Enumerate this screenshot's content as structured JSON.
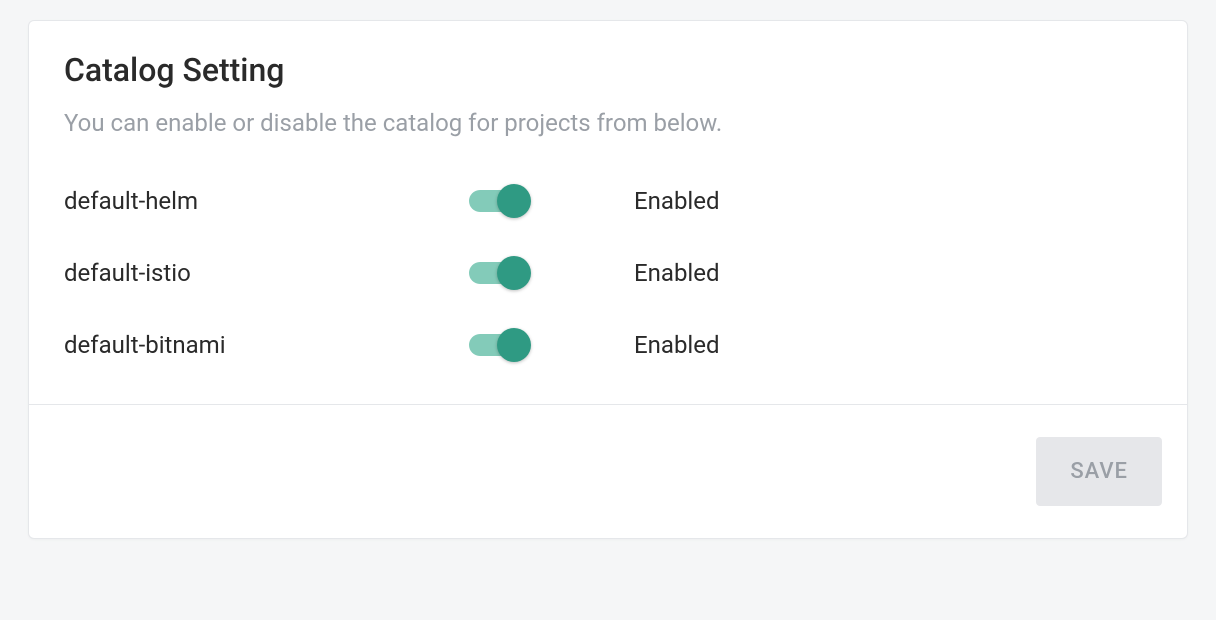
{
  "header": {
    "title": "Catalog Setting",
    "subtitle": "You can enable or disable the catalog for projects from below."
  },
  "catalogs": [
    {
      "name": "default-helm",
      "enabled": true,
      "statusLabel": "Enabled"
    },
    {
      "name": "default-istio",
      "enabled": true,
      "statusLabel": "Enabled"
    },
    {
      "name": "default-bitnami",
      "enabled": true,
      "statusLabel": "Enabled"
    }
  ],
  "footer": {
    "saveLabel": "SAVE"
  },
  "colors": {
    "toggleTrack": "#83cbb9",
    "toggleKnob": "#2f9a83"
  }
}
